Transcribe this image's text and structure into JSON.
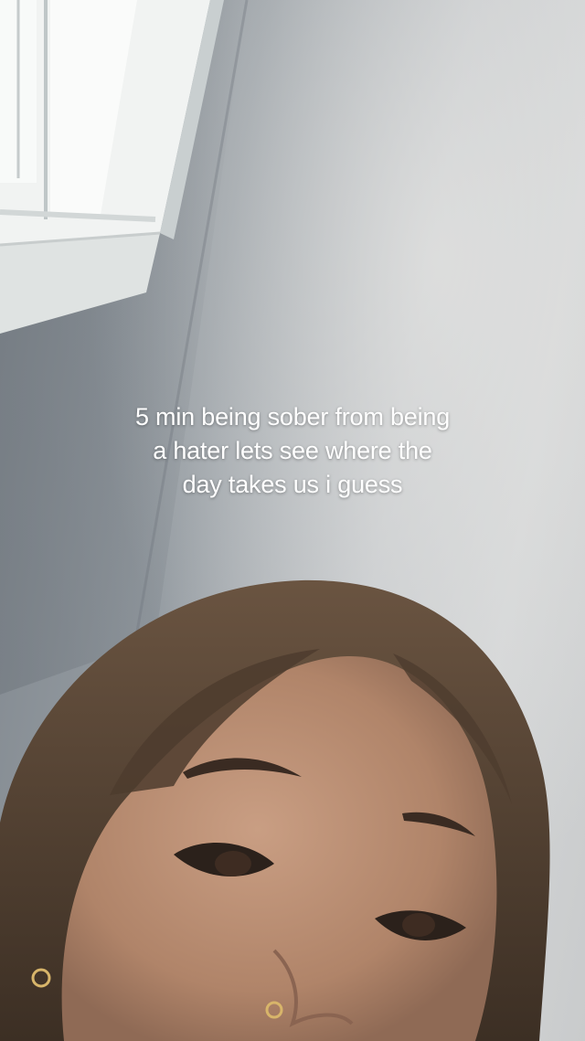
{
  "caption": {
    "lines": [
      "5 min being sober from being",
      "a hater lets see where the",
      "day takes us i guess"
    ]
  },
  "colors": {
    "caption_text": "#ffffff",
    "wall_shadow": "#7b8289",
    "wall_light": "#d3d5d6",
    "window_trim": "#e9eceb",
    "hair": "#4a3a2c",
    "skin": "#b98f76"
  }
}
